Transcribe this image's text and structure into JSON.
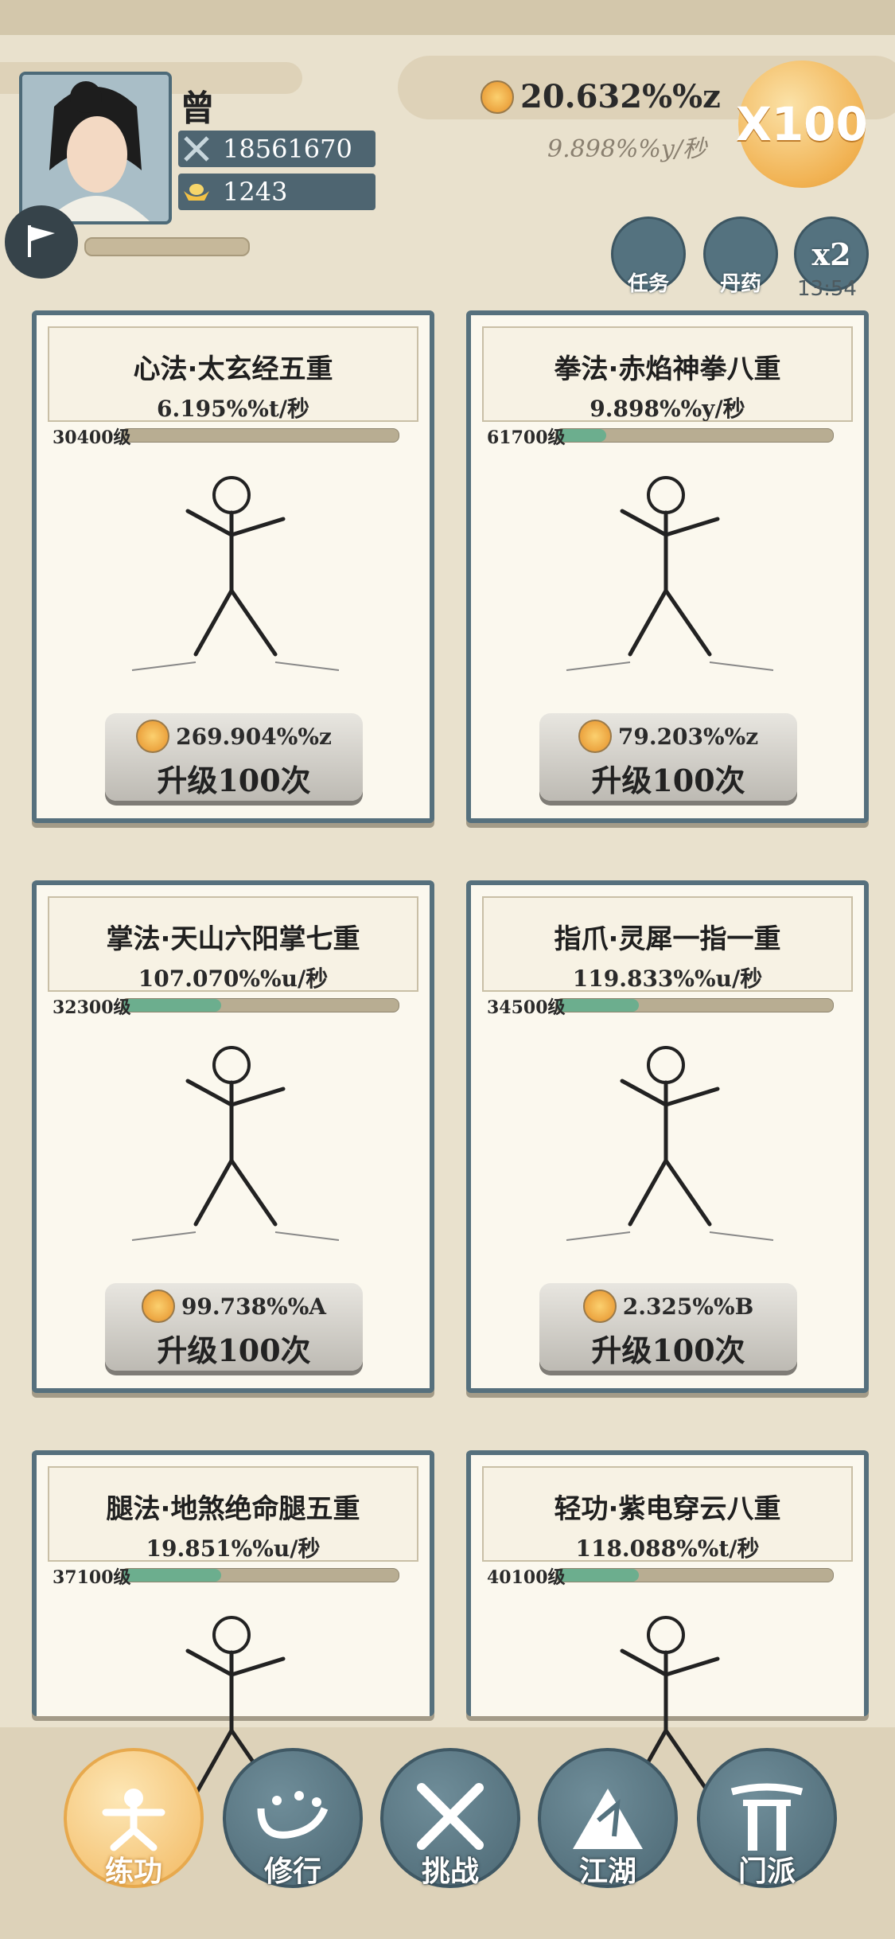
{
  "player": {
    "name": "曾",
    "power": "18561670",
    "gold": "1243"
  },
  "currency": {
    "amount": "20.632%%z",
    "rate": "9.898%%y/秒",
    "boost": "X100"
  },
  "buttons": {
    "task": "任务",
    "pill": "丹药",
    "double": "x2",
    "timer": "13:54"
  },
  "cards": [
    {
      "title": "心法·太玄经五重",
      "rate": "6.195%%t/秒",
      "level": "30400级",
      "cost": "269.904%%z",
      "upgrade": "升级100次",
      "progress": 0.0
    },
    {
      "title": "拳法·赤焰神拳八重",
      "rate": "9.898%%y/秒",
      "level": "61700级",
      "cost": "79.203%%z",
      "upgrade": "升级100次",
      "progress": 0.18
    },
    {
      "title": "掌法·天山六阳掌七重",
      "rate": "107.070%%u/秒",
      "level": "32300级",
      "cost": "99.738%%A",
      "upgrade": "升级100次",
      "progress": 0.36
    },
    {
      "title": "指爪·灵犀一指一重",
      "rate": "119.833%%u/秒",
      "level": "34500级",
      "cost": "2.325%%B",
      "upgrade": "升级100次",
      "progress": 0.3
    },
    {
      "title": "腿法·地煞绝命腿五重",
      "rate": "19.851%%u/秒",
      "level": "37100级",
      "progress": 0.36
    },
    {
      "title": "轻功·紫电穿云八重",
      "rate": "118.088%%t/秒",
      "level": "40100级",
      "progress": 0.3
    }
  ],
  "nav": [
    {
      "label": "练功",
      "icon": "training-icon",
      "active": true
    },
    {
      "label": "修行",
      "icon": "heart-icon",
      "active": false
    },
    {
      "label": "挑战",
      "icon": "swords-icon",
      "active": false
    },
    {
      "label": "江湖",
      "icon": "mountain-icon",
      "active": false
    },
    {
      "label": "门派",
      "icon": "gate-icon",
      "active": false
    }
  ]
}
